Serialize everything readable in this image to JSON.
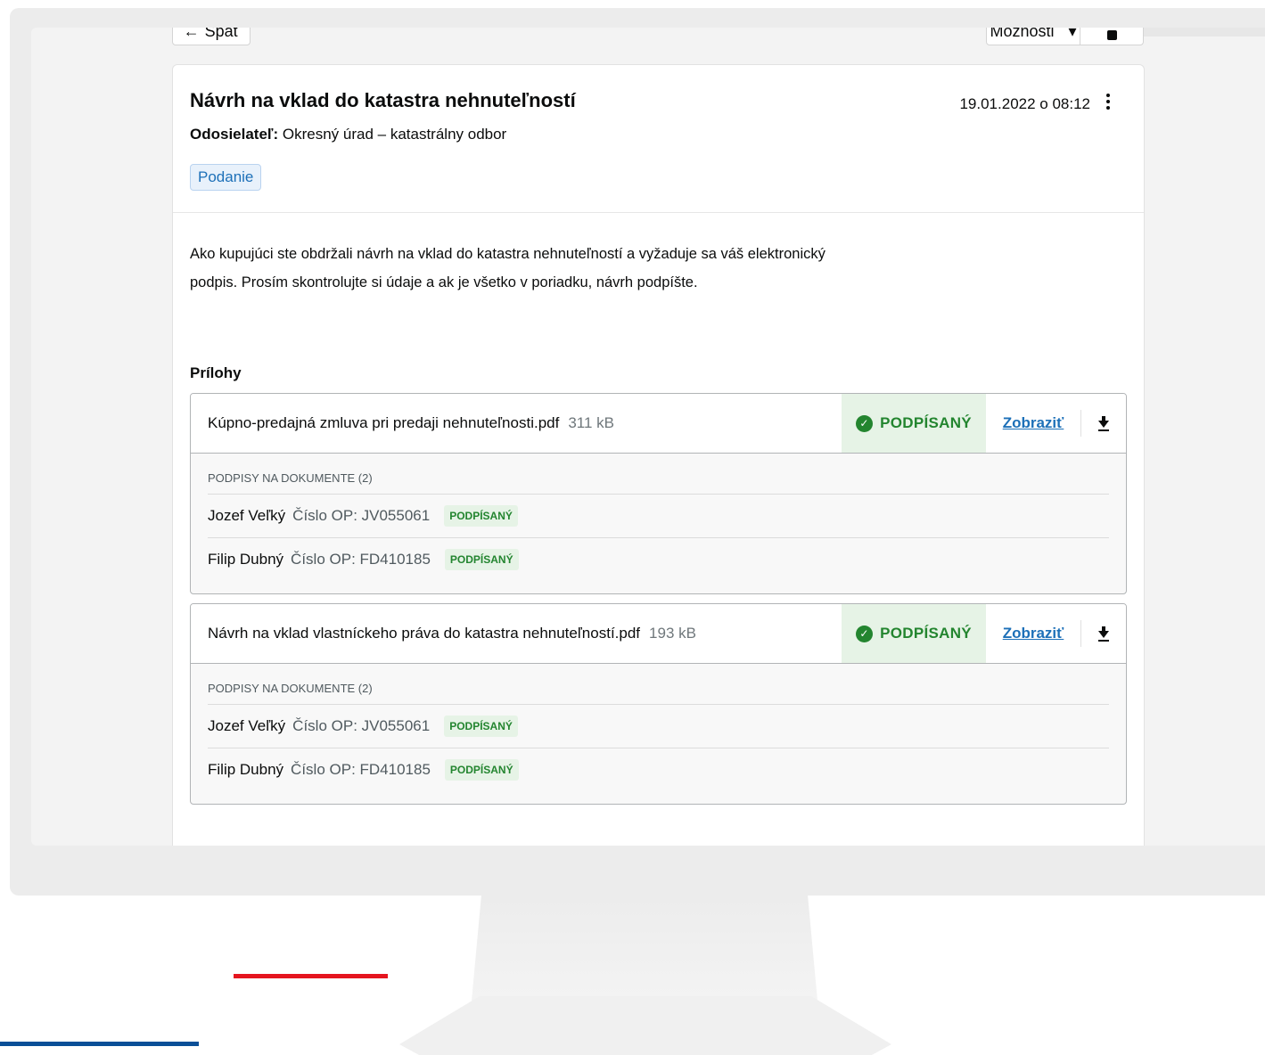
{
  "nav": {
    "back_label": "Späť",
    "options_label": "Možnosti"
  },
  "message": {
    "title": "Návrh na vklad do katastra nehnuteľností",
    "date": "19.01.2022 o 08:12",
    "sender_label": "Odosielateľ:",
    "sender_value": "Okresný úrad – katastrálny odbor",
    "tag": "Podanie",
    "body": "Ako kupujúci ste obdržali návrh na vklad do katastra nehnuteľností a vyžaduje sa váš elektronický podpis. Prosím skontrolujte si údaje a ak je všetko v poriadku, návrh podpíšte."
  },
  "attachments": {
    "title": "Prílohy",
    "items": [
      {
        "name": "Kúpno-predajná zmluva pri predaji nehnuteľnosti.pdf",
        "size": "311 kB",
        "status": "PODPÍSANÝ",
        "view_label": "Zobraziť",
        "signatures_header": "PODPISY NA DOKUMENTE (2)",
        "signatures": [
          {
            "name": "Jozef Veľký",
            "op": "Číslo OP: JV055061",
            "status": "PODPÍSANÝ"
          },
          {
            "name": "Filip Dubný",
            "op": "Číslo OP: FD410185",
            "status": "PODPÍSANÝ"
          }
        ]
      },
      {
        "name": "Návrh na vklad vlastníckeho práva do katastra nehnuteľností.pdf",
        "size": "193 kB",
        "status": "PODPÍSANÝ",
        "view_label": "Zobraziť",
        "signatures_header": "PODPISY NA DOKUMENTE (2)",
        "signatures": [
          {
            "name": "Jozef Veľký",
            "op": "Číslo OP: JV055061",
            "status": "PODPÍSANÝ"
          },
          {
            "name": "Filip Dubný",
            "op": "Číslo OP: FD410185",
            "status": "PODPÍSANÝ"
          }
        ]
      }
    ]
  },
  "colors": {
    "success": "#23852f",
    "link": "#1d70b8",
    "accent_red": "#e5151f",
    "accent_blue": "#0a4f97"
  }
}
